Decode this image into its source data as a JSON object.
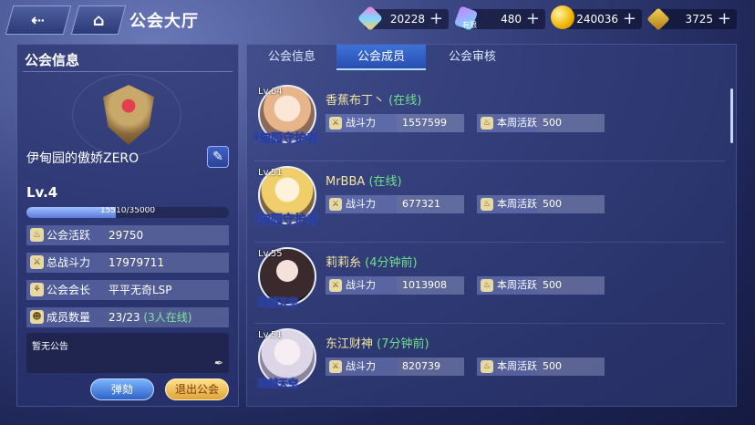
{
  "header": {
    "back_icon": "back-arrow-icon",
    "home_icon": "home-icon",
    "title": "公会大厅"
  },
  "resources": [
    {
      "name": "crystal",
      "value": "20228"
    },
    {
      "name": "limited-crystal",
      "tag": "有限",
      "value": "480"
    },
    {
      "name": "gold-coin",
      "value": "240036"
    },
    {
      "name": "medal",
      "value": "3725"
    }
  ],
  "guild": {
    "panel_title": "公会信息",
    "name": "伊甸园的傲娇ZERO",
    "level": "Lv.4",
    "xp_text": "15510/35000",
    "xp_fraction": 0.443,
    "stats": [
      {
        "label": "公会活跃",
        "value": "29750",
        "extra": ""
      },
      {
        "label": "总战斗力",
        "value": "17979711",
        "extra": ""
      },
      {
        "label": "公会会长",
        "value": "平平无奇LSP",
        "extra": ""
      },
      {
        "label": "成员数量",
        "value": "23/23 ",
        "extra": "(3人在线)"
      }
    ],
    "notice": "暂无公告",
    "btn_impeach": "弹劾",
    "btn_leave": "退出公会"
  },
  "tabs": [
    "公会信息",
    "公会成员",
    "公会审核"
  ],
  "members": [
    {
      "level": "Lv.64",
      "badge": "伊甸园守护者",
      "name": "香蕉布丁丶",
      "status": "(在线)",
      "power_label": "战斗力",
      "power": "1557599",
      "active_label": "本周活跃",
      "active": "500"
    },
    {
      "level": "Lv.51",
      "badge": "伊甸园守护者",
      "name": "MrBBA",
      "status": "(在线)",
      "power_label": "战斗力",
      "power": "677321",
      "active_label": "本周活跃",
      "active": "500"
    },
    {
      "level": "Lv.55",
      "badge": "跨越天空",
      "name": "莉莉糸",
      "status": "(4分钟前)",
      "power_label": "战斗力",
      "power": "1013908",
      "active_label": "本周活跃",
      "active": "500"
    },
    {
      "level": "Lv.51",
      "badge": "跨越天空",
      "name": "东江财神",
      "status": "(7分钟前)",
      "power_label": "战斗力",
      "power": "820739",
      "active_label": "本周活跃",
      "active": "500"
    }
  ]
}
